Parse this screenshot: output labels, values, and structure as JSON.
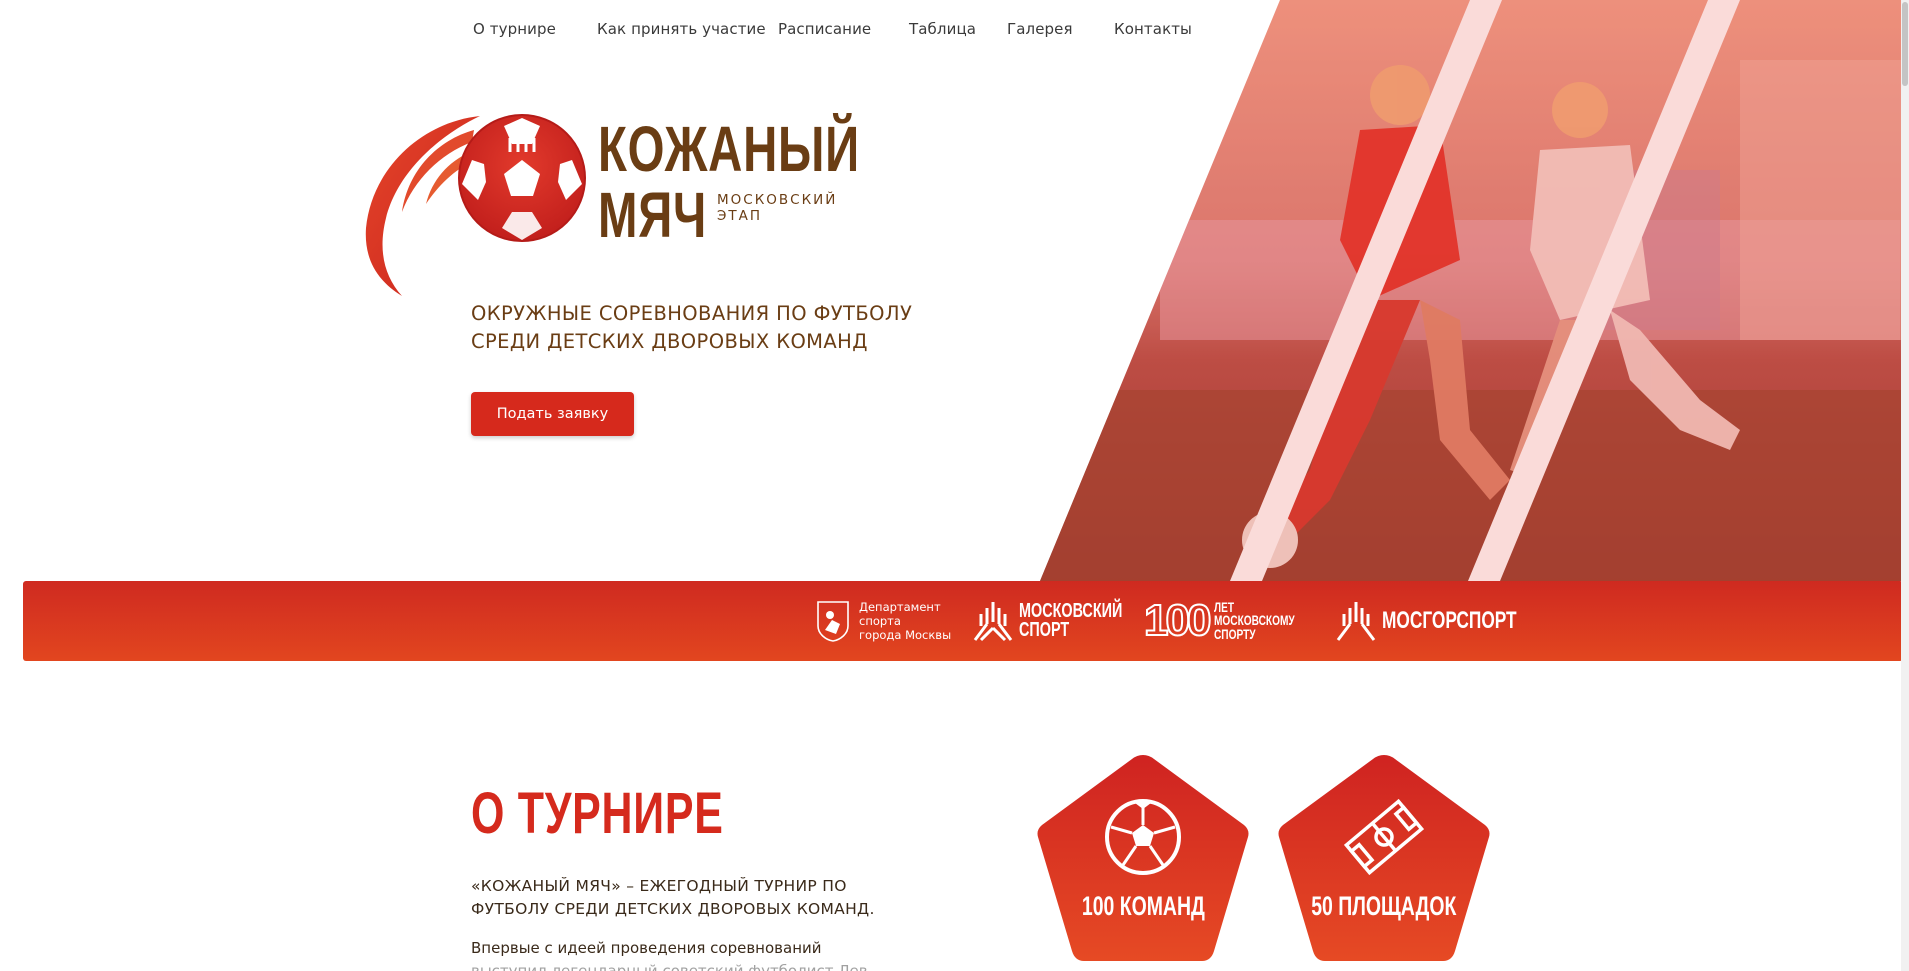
{
  "nav": {
    "items": [
      {
        "label": "О турнире"
      },
      {
        "label": "Как принять участие"
      },
      {
        "label": "Расписание"
      },
      {
        "label": "Таблица"
      },
      {
        "label": "Галерея"
      },
      {
        "label": "Контакты"
      }
    ]
  },
  "logo": {
    "title_line1": "КОЖАНЫЙ",
    "title_line2": "МЯЧ",
    "subtitle_line1": "МОСКОВСКИЙ",
    "subtitle_line2": "ЭТАП",
    "icon": "football-ball-icon"
  },
  "hero": {
    "heading_line1": "ОКРУЖНЫЕ СОРЕВНОВАНИЯ ПО ФУТБОЛУ",
    "heading_line2": "СРЕДИ ДЕТСКИХ ДВОРОВЫХ КОМАНД",
    "apply_button": "Подать заявку",
    "photo_icon": "football-players-photo"
  },
  "partners": {
    "department": {
      "line1": "Департамент",
      "line2": "спорта",
      "line3": "города Москвы",
      "icon": "moscow-coat-of-arms-icon"
    },
    "moscow_sport": {
      "line1": "МОСКОВСКИЙ",
      "line2": "СПОРТ",
      "icon": "moscow-sport-logo-icon"
    },
    "hundred_years": {
      "number": "100",
      "line1": "ЛЕТ",
      "line2": "МОСКОВСКОМУ",
      "line3": "СПОРТУ"
    },
    "mosgorsport": {
      "label": "МОСГОРСПОРТ",
      "icon": "mosgorsport-logo-icon"
    }
  },
  "about": {
    "title": "О ТУРНИРЕ",
    "lead_line1": "«КОЖАНЫЙ МЯЧ» – ЕЖЕГОДНЫЙ ТУРНИР ПО",
    "lead_line2": "ФУТБОЛУ СРЕДИ ДЕТСКИХ ДВОРОВЫХ КОМАНД.",
    "text_line1": "Впервые с идеей проведения соревнований",
    "text_line2": "выступил легендарный советский футболист Лев"
  },
  "stats": [
    {
      "label": "100 КОМАНД",
      "icon": "soccer-ball-icon"
    },
    {
      "label": "50 ПЛОЩАДОК",
      "icon": "football-field-icon"
    }
  ],
  "colors": {
    "brand_red": "#d6291c",
    "brand_brown": "#6a3d14",
    "strip_orange": "#e2461f"
  }
}
